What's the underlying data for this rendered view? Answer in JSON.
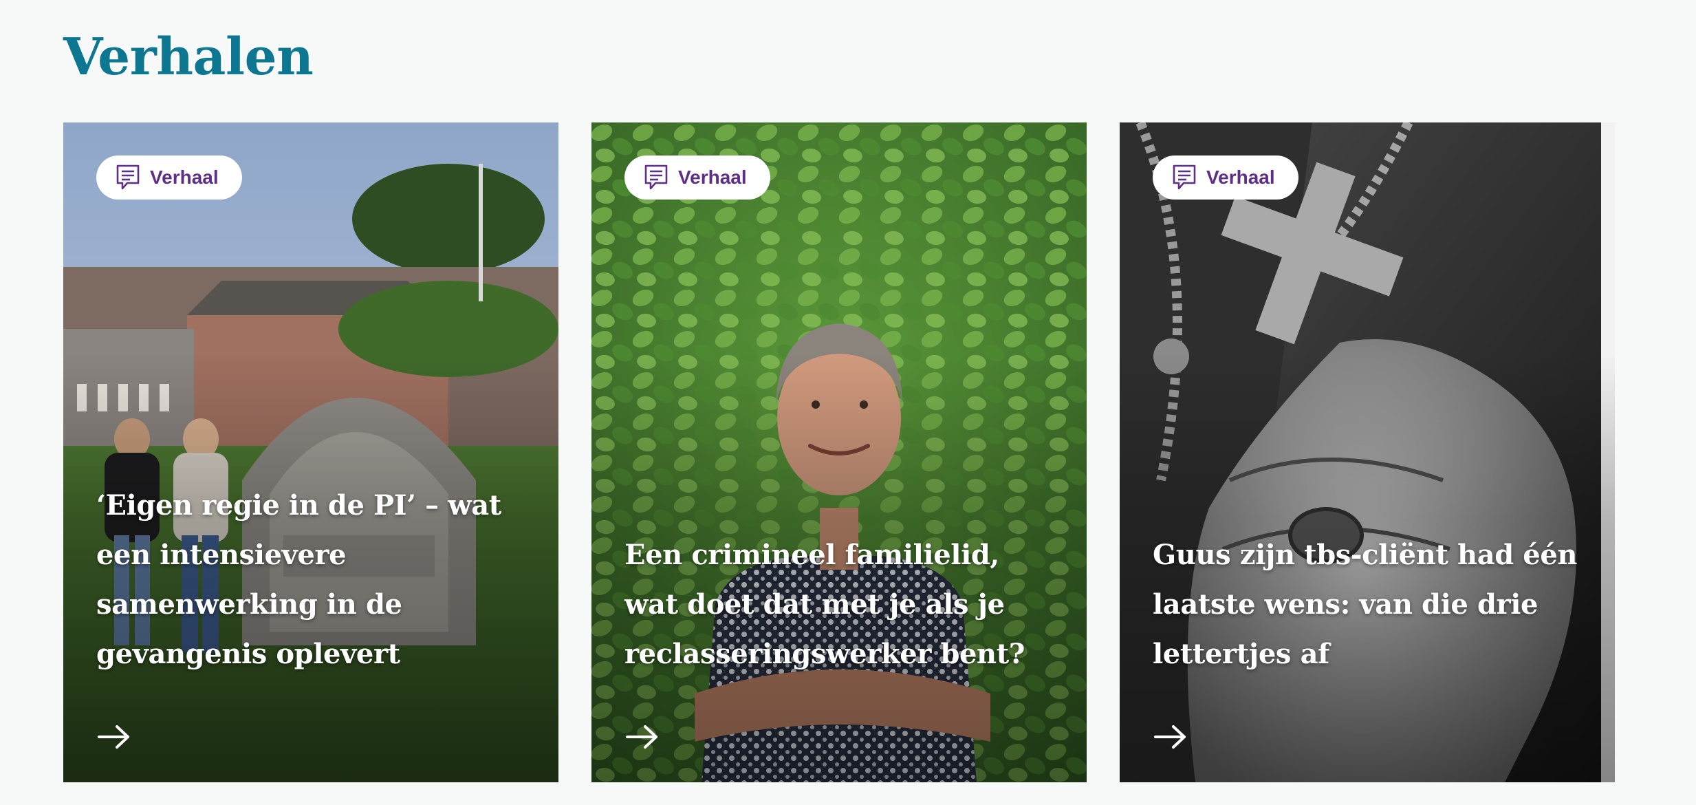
{
  "section": {
    "title": "Verhalen"
  },
  "cards": [
    {
      "badge_label": "Verhaal",
      "badge_icon": "comment-icon",
      "title": "‘Eigen regie in de PI’ – wat een intensievere samenwerking in de gevangenis oplevert",
      "link_icon": "arrow-right-icon"
    },
    {
      "badge_label": "Verhaal",
      "badge_icon": "comment-icon",
      "title": "Een crimineel familielid, wat doet dat met je als je reclasseringswerker bent?",
      "link_icon": "arrow-right-icon"
    },
    {
      "badge_label": "Verhaal",
      "badge_icon": "comment-icon",
      "title": "Guus zijn tbs-cliënt had één laatste wens: van die drie lettertjes af",
      "link_icon": "arrow-right-icon"
    }
  ],
  "colors": {
    "title": "#0d7690",
    "badge_text": "#5f2f87",
    "page_background": "#f7f8f8"
  }
}
